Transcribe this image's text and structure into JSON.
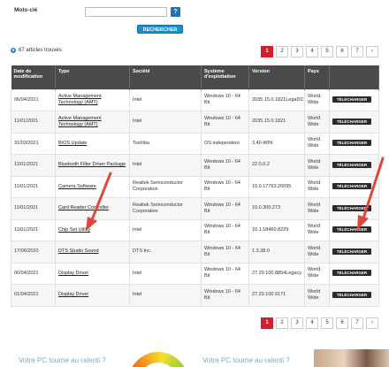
{
  "search": {
    "label": "Mots-clé",
    "input_value": "",
    "help_label": "?",
    "button_label": "RECHERCHER"
  },
  "results_count": "67 articles trouvés",
  "pagination": {
    "pages": [
      "1",
      "2",
      "3",
      "4",
      "5",
      "6",
      "7",
      "›"
    ],
    "active": "1"
  },
  "table": {
    "headers": {
      "date": "Date de modification",
      "type": "Type",
      "company": "Société",
      "os": "Système d'exploitation",
      "version": "Version",
      "system": "Pays",
      "download": ""
    },
    "download_label": "TÉLÉCHARGER",
    "rows": [
      {
        "date": "06/04/2021",
        "type": "Active Management Technology (AMT)",
        "company": "Intel",
        "os": "Windows 10 - 64 Bit",
        "version": "2035.15.0.1821LegaDC",
        "system": "World Wide"
      },
      {
        "date": "11/01/2021",
        "type": "Active Management Technology (AMT)",
        "company": "Intel",
        "os": "Windows 10 - 64 Bit",
        "version": "2035.15.0.1821",
        "system": "World Wide"
      },
      {
        "date": "31/03/2021",
        "type": "BIOS Update",
        "company": "Toshiba",
        "os": "OS independent",
        "version": "3.40-WIN",
        "system": "World Wide"
      },
      {
        "date": "11/01/2021",
        "type": "Bluetooth Filter Driver Package",
        "company": "Intel",
        "os": "Windows 10 - 64 Bit",
        "version": "22.0.0.2",
        "system": "World Wide"
      },
      {
        "date": "11/01/2021",
        "type": "Camera Software",
        "company": "Realtek Semiconductor Corporation",
        "os": "Windows 10 - 64 Bit",
        "version": "10.0.17763.20095",
        "system": "World Wide"
      },
      {
        "date": "11/01/2021",
        "type": "Card Reader Controller",
        "company": "Realtek Semiconductor Corporation",
        "os": "Windows 10 - 64 Bit",
        "version": "10.0.300.273",
        "system": "World Wide"
      },
      {
        "date": "11/01/2021",
        "type": "Chip Set Utility",
        "company": "Intel",
        "os": "Windows 10 - 64 Bit",
        "version": "10.1.18460.8229",
        "system": "World Wide"
      },
      {
        "date": "17/06/2020",
        "type": "DTS Studio Sound",
        "company": "DTS Inc.",
        "os": "Windows 10 - 64 Bit",
        "version": "1.3.38.0",
        "system": "World Wide"
      },
      {
        "date": "06/04/2021",
        "type": "Display Driver",
        "company": "Intel",
        "os": "Windows 10 - 64 Bit",
        "version": "27.20.100.8854Legacy",
        "system": "World Wide"
      },
      {
        "date": "01/04/2021",
        "type": "Display Driver",
        "company": "Intel",
        "os": "Windows 10 - 64 Bit",
        "version": "27.20.100.9171",
        "system": "World Wide"
      }
    ]
  },
  "promo": {
    "left": "Votre PC tourne au ralenti ?",
    "right": "Votre PC tourne au ralenti ?"
  },
  "colors": {
    "header_bg": "#4a4a4a",
    "page_active": "#d01f2e",
    "accent_blue": "#1a8fd2",
    "arrow": "#e0473c"
  }
}
